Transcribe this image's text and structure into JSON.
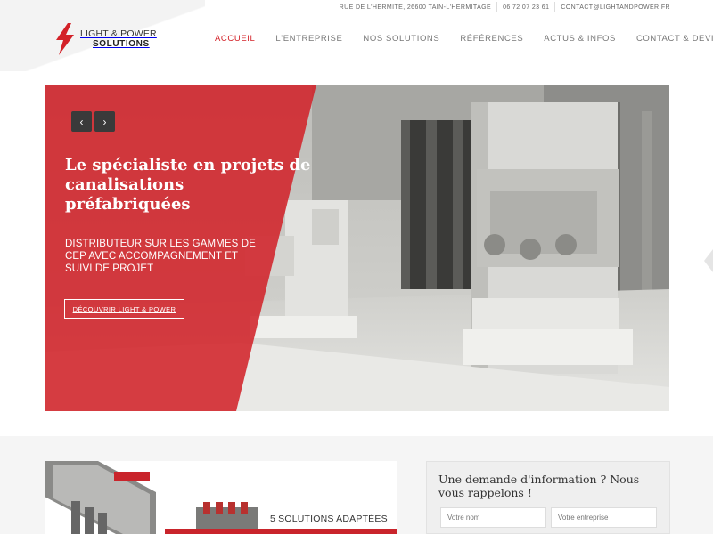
{
  "topbar": {
    "address": "RUE DE L'HERMITE, 26600 TAIN-L'HERMITAGE",
    "phone": "06 72 07 23 61",
    "email": "CONTACT@LIGHTANDPOWER.FR"
  },
  "brand": {
    "line1": "LIGHT & POWER",
    "line2": "SOLUTIONS",
    "accent_color": "#d32128"
  },
  "nav": {
    "items": [
      {
        "label": "ACCUEIL",
        "active": true
      },
      {
        "label": "L'ENTREPRISE",
        "active": false
      },
      {
        "label": "NOS SOLUTIONS",
        "active": false
      },
      {
        "label": "RÉFÉRENCES",
        "active": false
      },
      {
        "label": "ACTUS & INFOS",
        "active": false
      },
      {
        "label": "CONTACT & DEVIS",
        "active": false
      }
    ]
  },
  "hero": {
    "prev_icon": "‹",
    "next_icon": "›",
    "title": "Le spécialiste en projets de canalisations préfabriquées",
    "subtitle": "DISTRIBUTEUR SUR LES GAMMES DE CEP AVEC ACCOMPAGNEMENT ET SUIVI DE PROJET",
    "cta_label": "DÉCOUVRIR LIGHT & POWER"
  },
  "solutions": {
    "label": "5 SOLUTIONS ADAPTÉES"
  },
  "contact_form": {
    "title": "Une demande d'information ? Nous vous rappelons !",
    "name_placeholder": "Votre nom",
    "company_placeholder": "Votre entreprise"
  }
}
